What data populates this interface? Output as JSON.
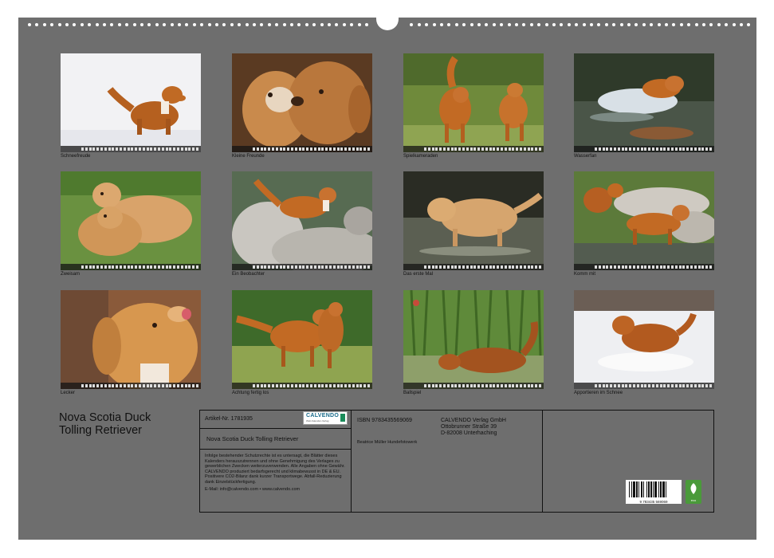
{
  "document": {
    "title_line1": "Nova Scotia Duck",
    "title_line2": "Tolling Retriever"
  },
  "photos": [
    {
      "caption": "Schneefreude",
      "scene": "dog-in-snow"
    },
    {
      "caption": "Kleine Freunde",
      "scene": "two-dogs-closeup"
    },
    {
      "caption": "Spielkameraden",
      "scene": "two-dogs-meadow"
    },
    {
      "caption": "Wasserfan",
      "scene": "dog-in-water-splash"
    },
    {
      "caption": "Zweisam",
      "scene": "two-puppies-grass"
    },
    {
      "caption": "Ein Beobachter",
      "scene": "dog-on-rocks"
    },
    {
      "caption": "Das erste Mal",
      "scene": "puppy-in-water"
    },
    {
      "caption": "Komm mit",
      "scene": "two-dogs-rocks-water"
    },
    {
      "caption": "Lecker",
      "scene": "dog-licking-portrait"
    },
    {
      "caption": "Achtung fertig los",
      "scene": "two-dogs-play"
    },
    {
      "caption": "Ballspiel",
      "scene": "dog-running-cornfield"
    },
    {
      "caption": "Apportieren im Schnee",
      "scene": "dog-running-snow"
    }
  ],
  "info_box": {
    "article_label": "Artikel-Nr. 1781935",
    "logo_text": "CALVENDO",
    "logo_sub": "Welt-Kalender-Verlag",
    "isbn": "ISBN 9783435569069",
    "publisher_line1": "CALVENDO Verlag GmbH",
    "publisher_line2": "Ottobrunner Straße 39",
    "publisher_line3": "D-82008 Unterhaching",
    "calendar_title": "Nova Scotia Duck Tolling Retriever",
    "author": "Beatrice Müller Hundefotowerk",
    "legal_text": "Infolge bestehender Schutzrechte ist es untersagt, die Blätter dieses Kalenders herauszutrennen und ohne Genehmigung des Verlages zu gewerblichen Zwecken weiterzuverwenden. Alle Angaben ohne Gewähr. CALVENDO produziert bedarfsgerecht und klimabewusst in DE & EU. Positivere CO2-Bilanz dank kurzer Transportwege. Abfall-Reduzierung dank Einzelstückfertigung.",
    "email": "E-Mail: info@calvendo.com • www.calvendo.com",
    "barcode_digits": "9 783435 569069",
    "eco_label": "eco"
  },
  "colors": {
    "page_background": "#6e6e6e",
    "logo_blue": "#1b6c8b",
    "eco_green": "#4a9a3a"
  }
}
